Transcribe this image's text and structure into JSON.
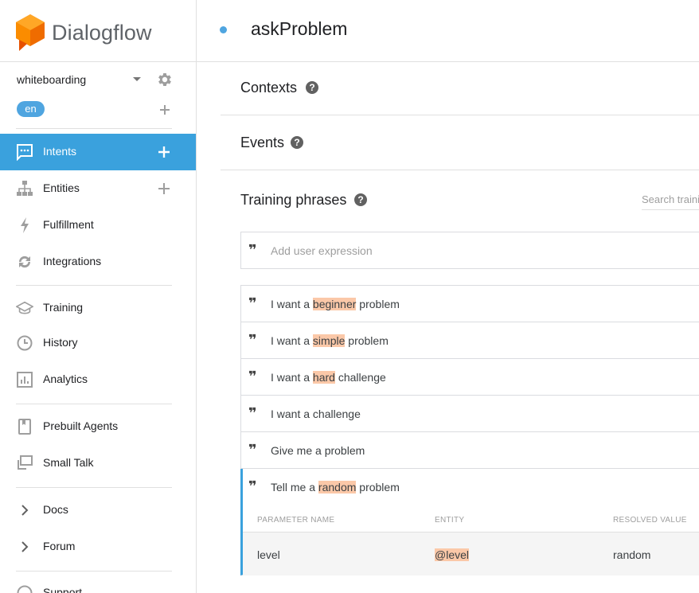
{
  "app": {
    "name": "Dialogflow",
    "accent": "#3aa1dd",
    "logo_color": "#f57c00"
  },
  "agent": {
    "name": "whiteboarding",
    "language": "en"
  },
  "sidebar": {
    "items": [
      {
        "label": "Intents",
        "icon": "chat-bubble-icon",
        "active": true,
        "add": true
      },
      {
        "label": "Entities",
        "icon": "sitemap-icon",
        "add": true
      },
      {
        "label": "Fulfillment",
        "icon": "lightning-icon"
      },
      {
        "label": "Integrations",
        "icon": "sync-icon"
      },
      {
        "label": "Training",
        "icon": "graduation-cap-icon"
      },
      {
        "label": "History",
        "icon": "clock-icon"
      },
      {
        "label": "Analytics",
        "icon": "bar-chart-icon"
      },
      {
        "label": "Prebuilt Agents",
        "icon": "book-icon"
      },
      {
        "label": "Small Talk",
        "icon": "chat-boxes-icon"
      },
      {
        "label": "Docs",
        "icon": "chevron-right-icon"
      },
      {
        "label": "Forum",
        "icon": "chevron-right-icon"
      },
      {
        "label": "Support",
        "icon": "help-circle-icon"
      }
    ]
  },
  "intent": {
    "title": "askProblem"
  },
  "sections": {
    "contexts": "Contexts",
    "events": "Events",
    "training": "Training phrases"
  },
  "search": {
    "placeholder": "Search training phrases"
  },
  "add_expression": {
    "placeholder": "Add user expression"
  },
  "phrases": [
    {
      "before": "I want a ",
      "entity": "beginner",
      "after": " problem"
    },
    {
      "before": "I want a ",
      "entity": "simple",
      "after": " problem"
    },
    {
      "before": "I want a ",
      "entity": "hard",
      "after": " challenge"
    },
    {
      "before": "I want a challenge",
      "entity": "",
      "after": ""
    },
    {
      "before": "Give me a problem",
      "entity": "",
      "after": ""
    },
    {
      "before": "Tell me a ",
      "entity": "random",
      "after": " problem"
    }
  ],
  "parameters": {
    "headers": [
      "PARAMETER NAME",
      "ENTITY",
      "RESOLVED VALUE"
    ],
    "rows": [
      {
        "name": "level",
        "entity": "@level",
        "value": "random"
      }
    ]
  }
}
